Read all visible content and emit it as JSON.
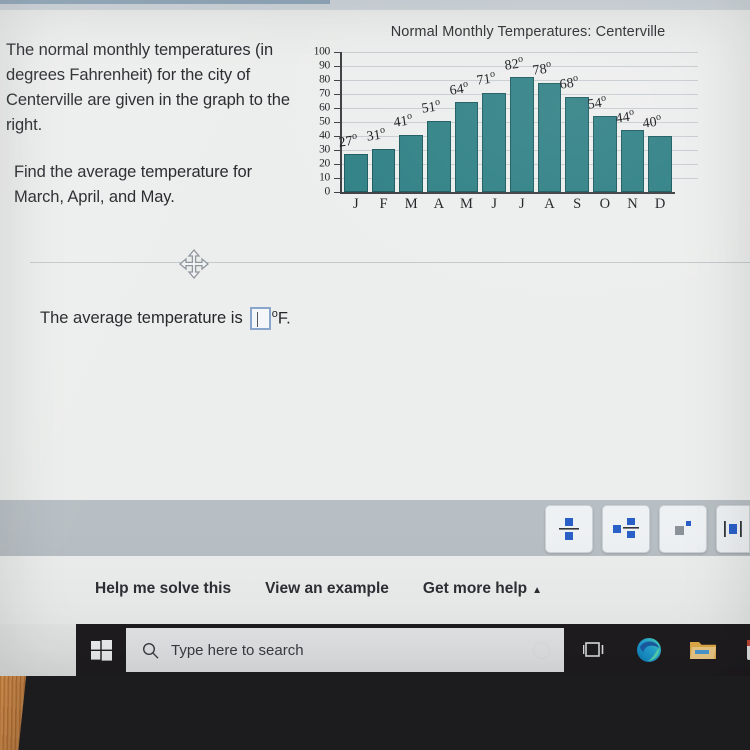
{
  "problem": {
    "paragraph1": "The normal monthly temperatures (in degrees Fahrenheit) for the city of Centerville are given in the graph to the right.",
    "paragraph2": "Find the average temperature for March, April, and May."
  },
  "answer": {
    "prefix": "The average temperature is",
    "input_value": "",
    "unit": "F.",
    "degree_symbol": "o"
  },
  "chart_data": {
    "type": "bar",
    "title": "Normal Monthly Temperatures: Centerville",
    "xlabel": "",
    "ylabel": "",
    "categories": [
      "J",
      "F",
      "M",
      "A",
      "M",
      "J",
      "J",
      "A",
      "S",
      "O",
      "N",
      "D"
    ],
    "values": [
      27,
      31,
      41,
      51,
      64,
      71,
      82,
      78,
      68,
      54,
      44,
      40
    ],
    "value_labels": [
      "27o",
      "31o",
      "41o",
      "51o",
      "64o",
      "71o",
      "82o",
      "78o",
      "68o",
      "54o",
      "44o",
      "40o"
    ],
    "ylim": [
      0,
      100
    ],
    "yticks": [
      0,
      10,
      20,
      30,
      40,
      50,
      60,
      70,
      80,
      90,
      100
    ],
    "grid": true,
    "legend": "none",
    "bar_color": "#2d7f84",
    "bar_border_color": "#17585c"
  },
  "palette": {
    "buttons": [
      {
        "name": "fraction-template",
        "label": "fraction"
      },
      {
        "name": "mixed-number-template",
        "label": "mixed number"
      },
      {
        "name": "exponent-template",
        "label": "exponent"
      },
      {
        "name": "absolute-value-template",
        "label": "absolute value"
      }
    ]
  },
  "help": {
    "links": [
      {
        "name": "help-me-solve-this",
        "label": "Help me solve this",
        "caret": ""
      },
      {
        "name": "view-an-example",
        "label": "View an example",
        "caret": ""
      },
      {
        "name": "get-more-help",
        "label": "Get more help",
        "caret": "▲"
      }
    ]
  },
  "taskbar": {
    "search_placeholder": "Type here to search",
    "icons": [
      "cortana-icon",
      "task-view-icon",
      "microsoft-edge-icon",
      "file-explorer-icon",
      "app-icon"
    ]
  }
}
